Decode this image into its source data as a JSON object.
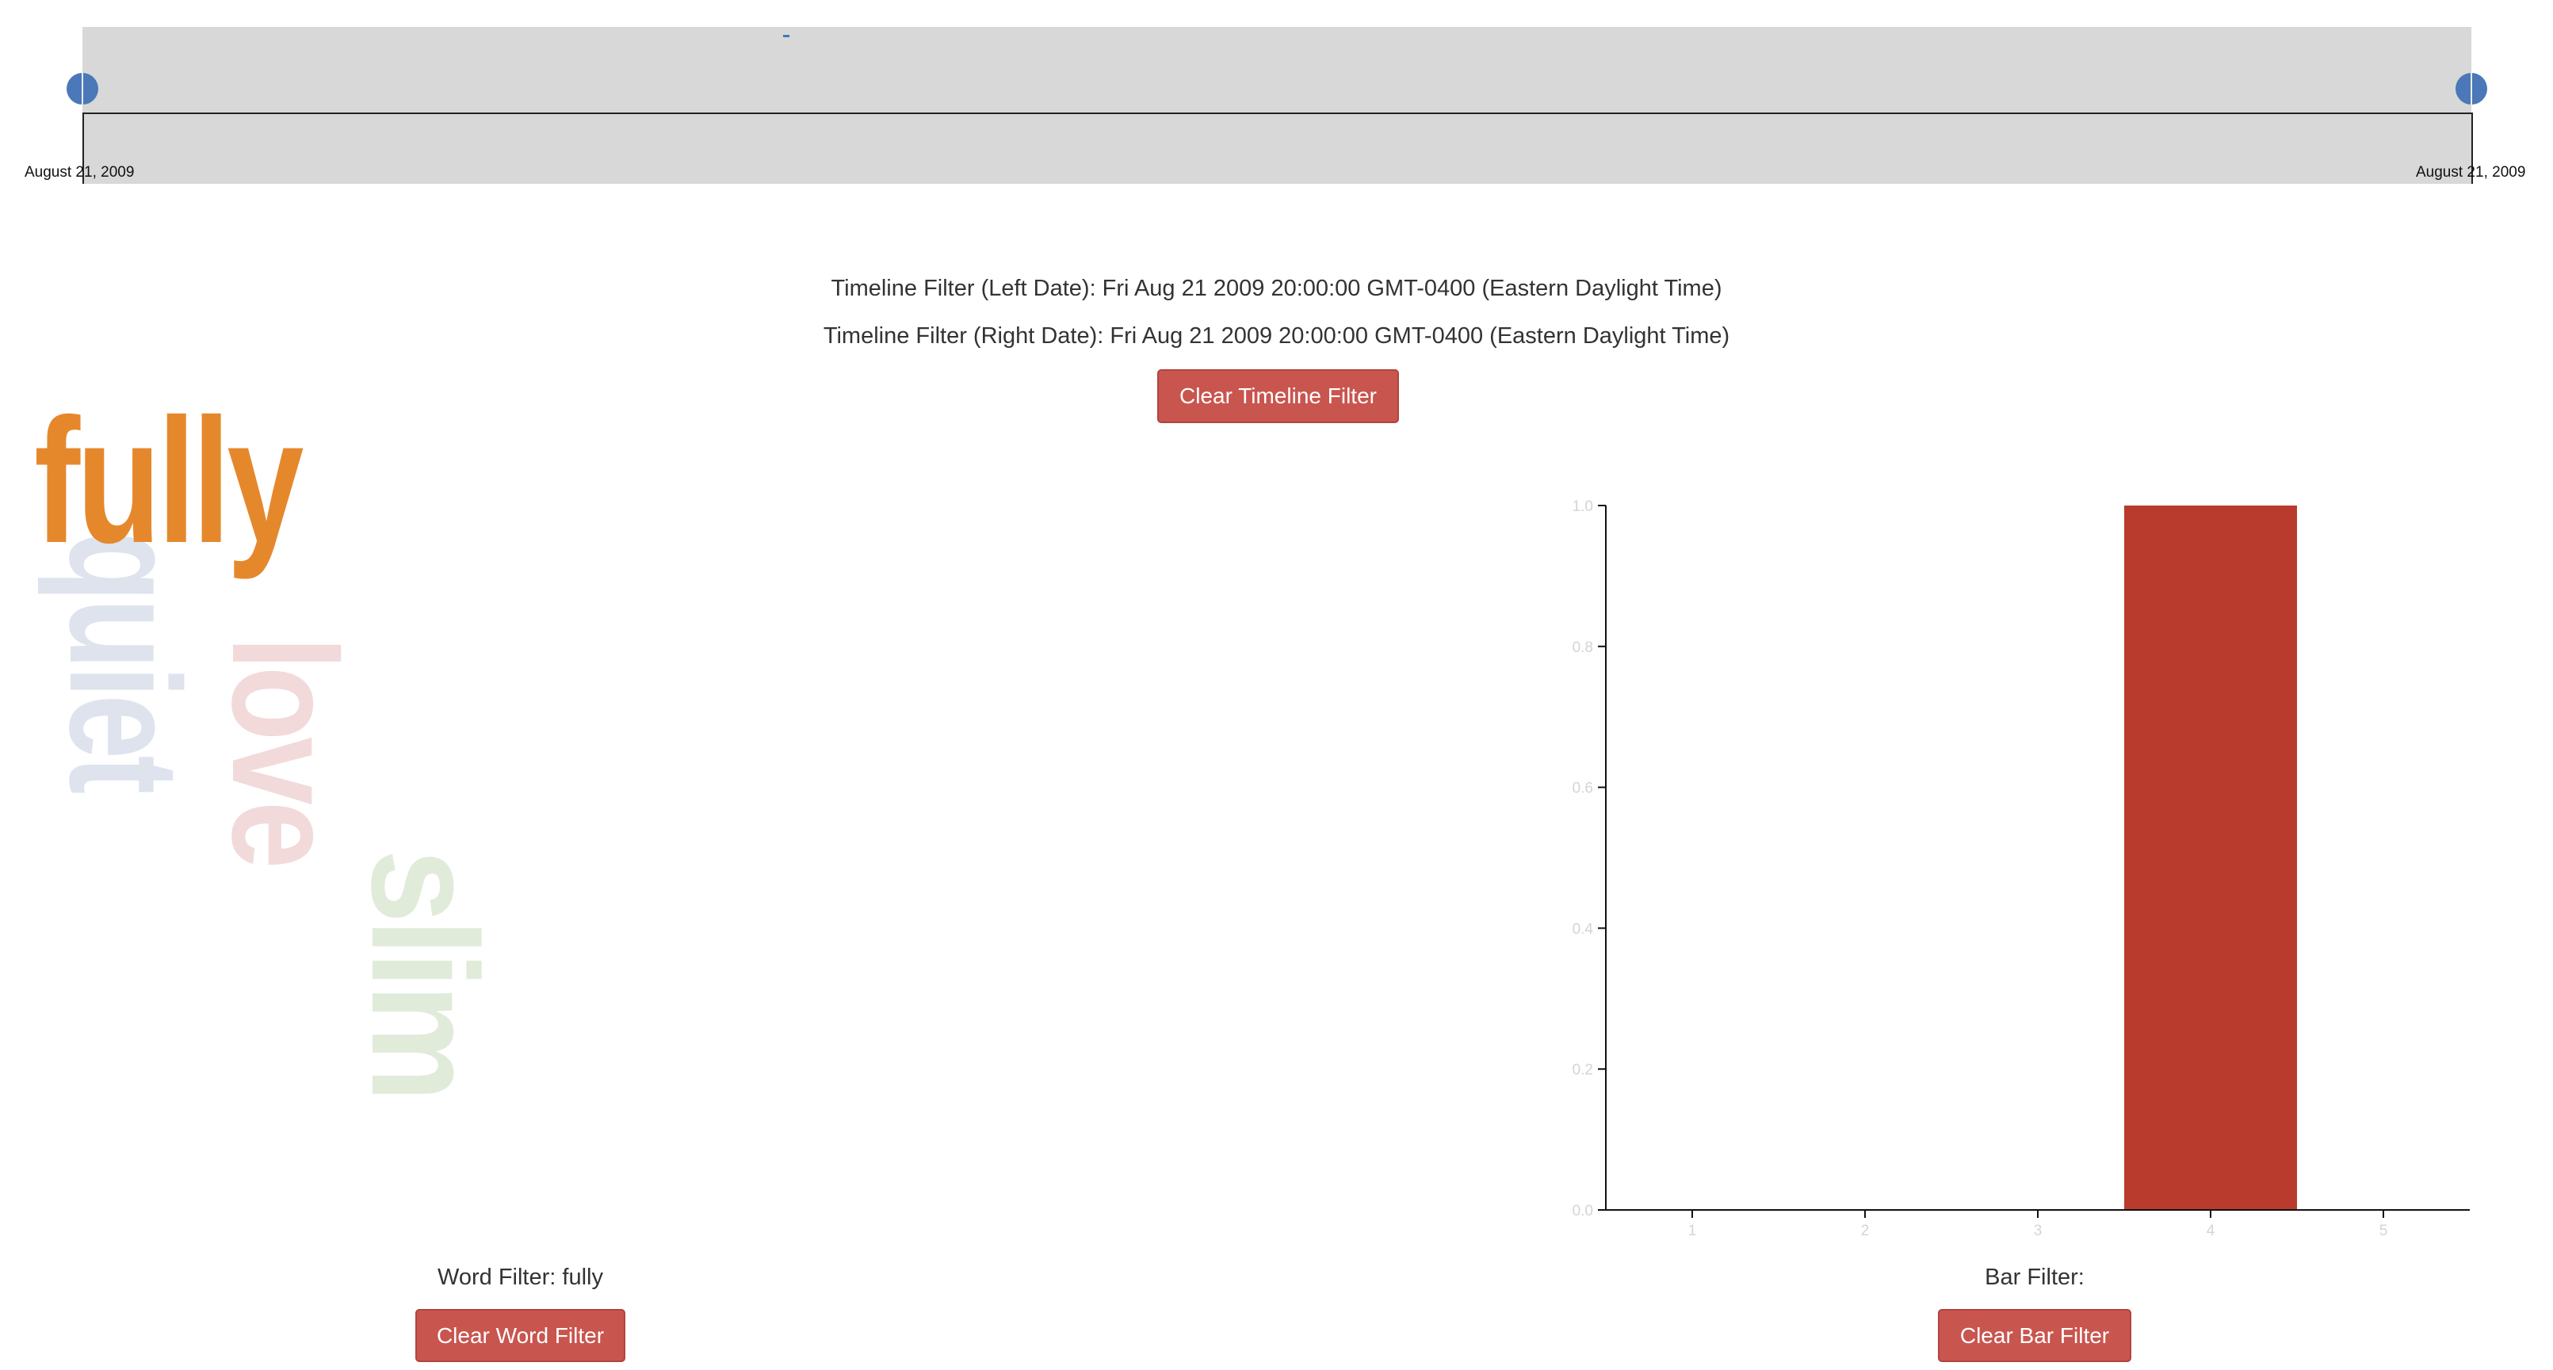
{
  "timeline": {
    "left_label": "August 21, 2009",
    "right_label": "August 21, 2009"
  },
  "timeline_filter": {
    "left_date_text": "Timeline Filter (Left Date): Fri Aug 21 2009 20:00:00 GMT-0400 (Eastern Daylight Time)",
    "right_date_text": "Timeline Filter (Right Date): Fri Aug 21 2009 20:00:00 GMT-0400 (Eastern Daylight Time)",
    "clear_button_label": "Clear Timeline Filter"
  },
  "word_cloud": {
    "words": [
      {
        "text": "fully",
        "color": "#e5882c",
        "orientation": "horizontal"
      },
      {
        "text": "quiet",
        "color": "#dee3ee",
        "orientation": "vertical"
      },
      {
        "text": "love",
        "color": "#f2dada",
        "orientation": "vertical"
      },
      {
        "text": "slim",
        "color": "#e0ebd9",
        "orientation": "vertical"
      }
    ],
    "filter_text": "Word Filter: fully",
    "clear_button_label": "Clear Word Filter"
  },
  "bar_filter": {
    "filter_text": "Bar Filter:",
    "clear_button_label": "Clear Bar Filter"
  },
  "colors": {
    "bar": "#b83b2e",
    "button": "#c9554f",
    "timeline_background": "#d8d8d8",
    "handle": "#4a78b8"
  },
  "chart_data": {
    "type": "bar",
    "categories": [
      "1",
      "2",
      "3",
      "4",
      "5"
    ],
    "values": [
      0,
      0,
      0,
      1,
      0
    ],
    "ylim": [
      0,
      1
    ],
    "yticks": [
      "0.0",
      "0.2",
      "0.4",
      "0.6",
      "0.8",
      "1.0"
    ],
    "title": "",
    "xlabel": "",
    "ylabel": "",
    "grid": false
  }
}
